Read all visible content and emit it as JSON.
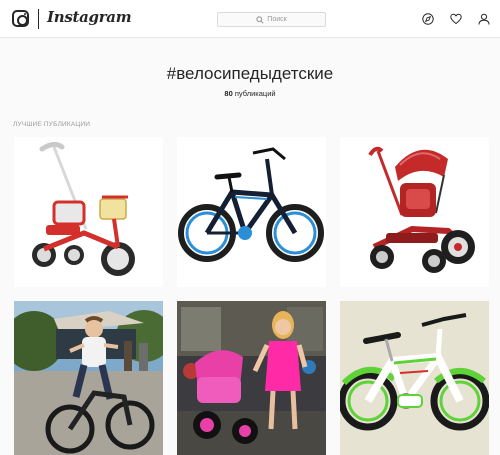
{
  "app": {
    "wordmark": "Instagram"
  },
  "search": {
    "placeholder": "Поиск"
  },
  "nav": {
    "icons": [
      "compass-icon",
      "heart-icon",
      "profile-icon"
    ]
  },
  "hashtag": {
    "title": "#велосипедыдетские",
    "post_count": "80",
    "post_count_suffix": "публикаций"
  },
  "section": {
    "label": "ЛУЧШИЕ ПУБЛИКАЦИИ"
  },
  "posts": [
    {
      "subject": "red children's tricycle with parent handle"
    },
    {
      "subject": "black and blue children's bicycle"
    },
    {
      "subject": "red tricycle with canopy"
    },
    {
      "subject": "boy riding bicycle in park"
    },
    {
      "subject": "woman with pink tricycle in store"
    },
    {
      "subject": "green and white children's bicycle"
    }
  ],
  "colors": {
    "background": "#fafafa",
    "header_bg": "#ffffff",
    "text": "#262626",
    "muted": "#999999"
  }
}
